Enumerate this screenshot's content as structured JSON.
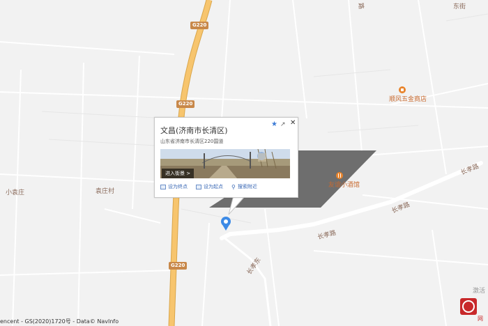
{
  "map": {
    "place_labels": [
      "小袁庄",
      "袁庄村",
      "顺风五金商店",
      "友谊小酒馆",
      "激活"
    ],
    "road_labels": [
      "长孝路",
      "长孝路",
      "长孝路",
      "长孝东"
    ],
    "top_road_labels": [
      "路",
      "东街"
    ],
    "highway": "G220"
  },
  "popup": {
    "title": "文昌(济南市长清区)",
    "address": "山东省济南市长清区220国道",
    "streetview_button": "进入街景 >",
    "actions": [
      "设为终点",
      "设为起点",
      "搜索附近"
    ]
  },
  "credit": "encent - GS(2020)1720号 - Data© NavInfo",
  "watermark_text": "网"
}
